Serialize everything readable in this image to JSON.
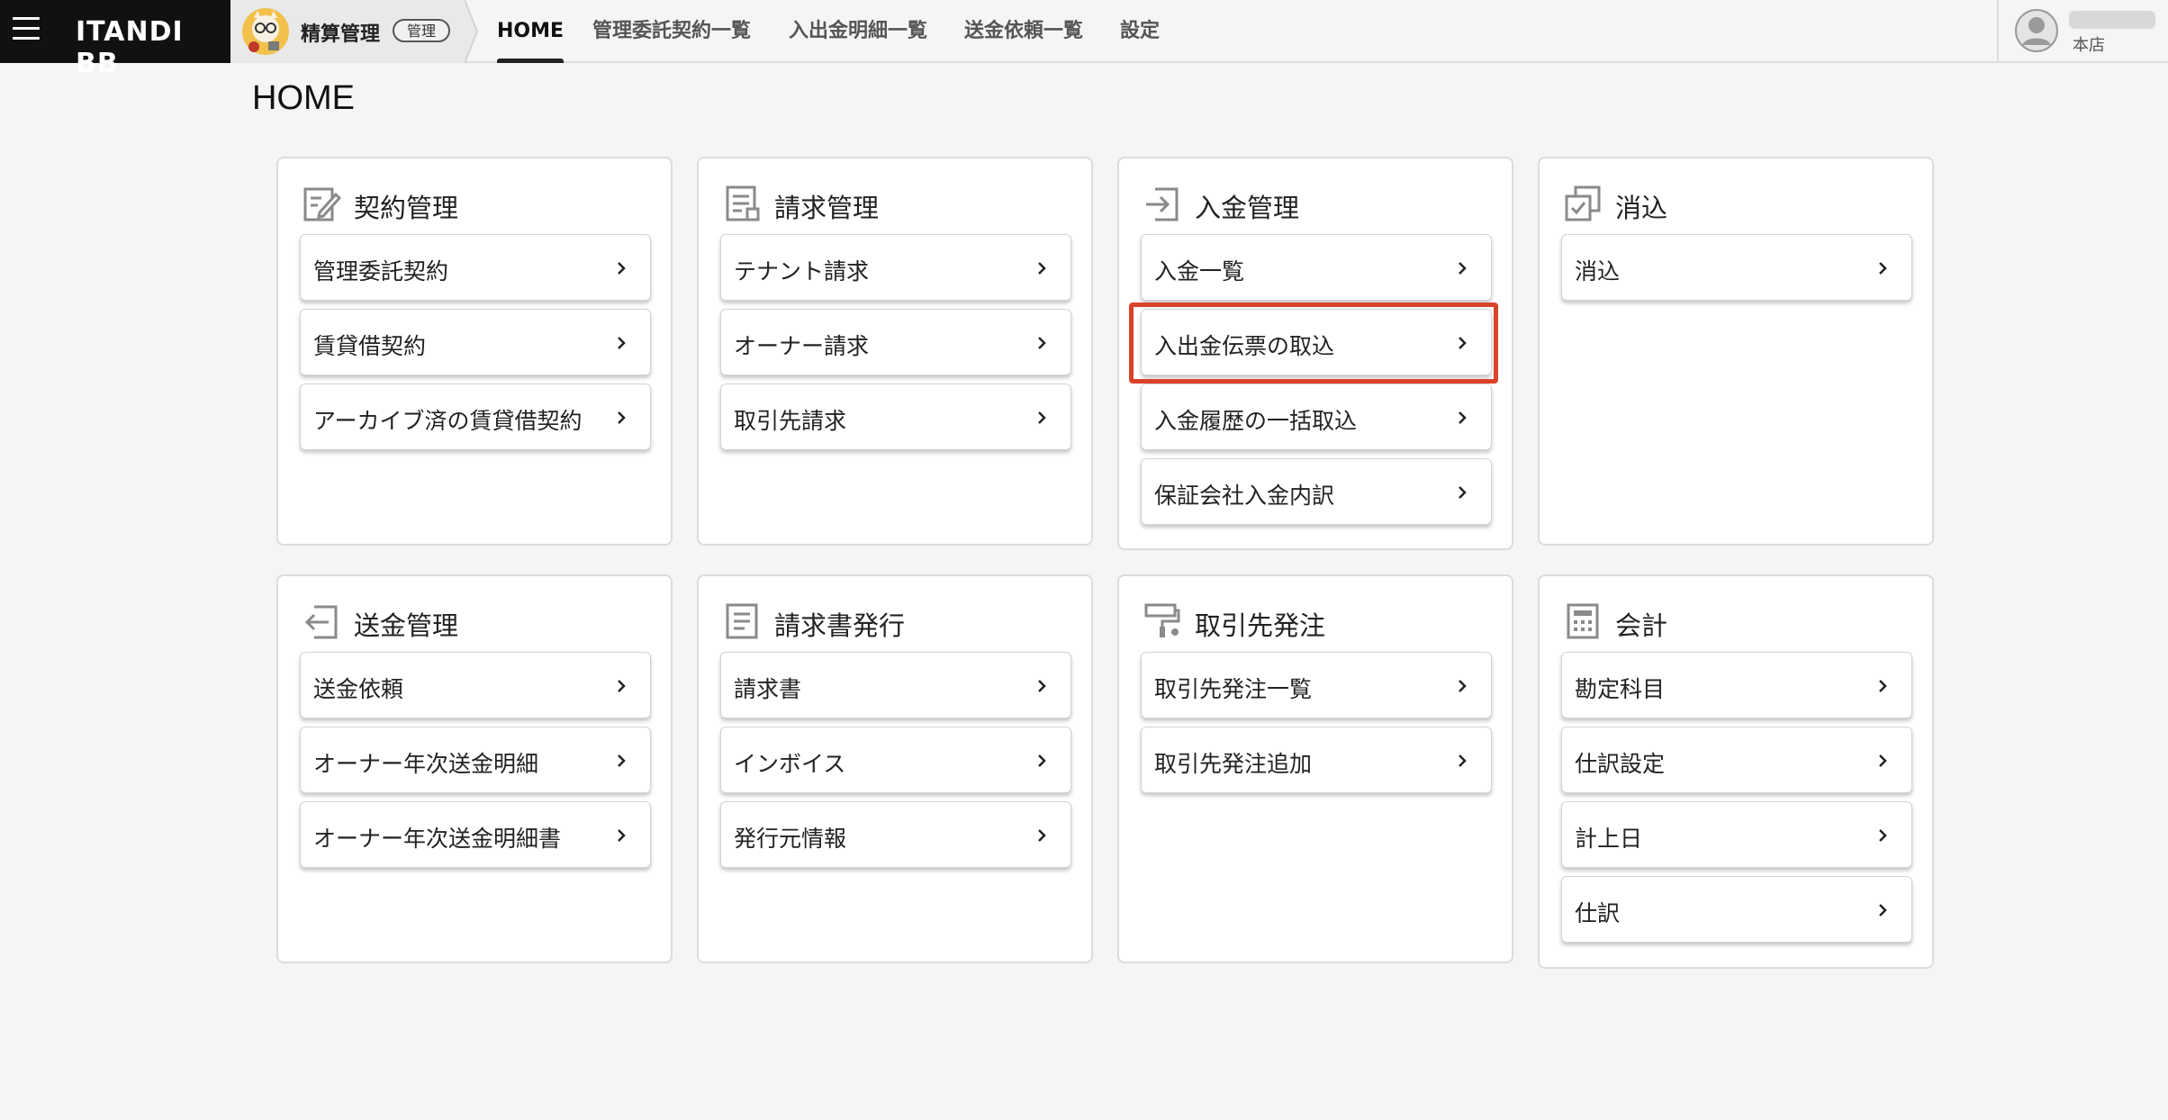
{
  "header": {
    "brand": "ITANDI BB",
    "app_name": "精算管理",
    "app_badge": "管理",
    "nav": [
      "HOME",
      "管理委託契約一覧",
      "入出金明細一覧",
      "送金依頼一覧",
      "設定"
    ],
    "active_nav": "HOME",
    "user_branch": "本店"
  },
  "page": {
    "title": "HOME"
  },
  "cards": [
    {
      "title": "契約管理",
      "icon": "contract-edit-icon",
      "items": [
        "管理委託契約",
        "賃貸借契約",
        "アーカイブ済の賃貸借契約"
      ]
    },
    {
      "title": "請求管理",
      "icon": "invoice-list-icon",
      "items": [
        "テナント請求",
        "オーナー請求",
        "取引先請求"
      ]
    },
    {
      "title": "入金管理",
      "icon": "deposit-in-icon",
      "items": [
        "入金一覧",
        "入出金伝票の取込",
        "入金履歴の一括取込",
        "保証会社入金内訳"
      ]
    },
    {
      "title": "消込",
      "icon": "reconcile-check-icon",
      "items": [
        "消込"
      ]
    },
    {
      "title": "送金管理",
      "icon": "remit-out-icon",
      "items": [
        "送金依頼",
        "オーナー年次送金明細",
        "オーナー年次送金明細書"
      ]
    },
    {
      "title": "請求書発行",
      "icon": "document-icon",
      "items": [
        "請求書",
        "インボイス",
        "発行元情報"
      ]
    },
    {
      "title": "取引先発注",
      "icon": "paint-roller-icon",
      "items": [
        "取引先発注一覧",
        "取引先発注追加"
      ]
    },
    {
      "title": "会計",
      "icon": "calculator-icon",
      "items": [
        "勘定科目",
        "仕訳設定",
        "計上日",
        "仕訳"
      ]
    }
  ],
  "highlighted_item": "入出金伝票の取込",
  "colors": {
    "highlight": "#d9432a",
    "brand_bg": "#111111",
    "page_bg": "#f5f5f6"
  }
}
